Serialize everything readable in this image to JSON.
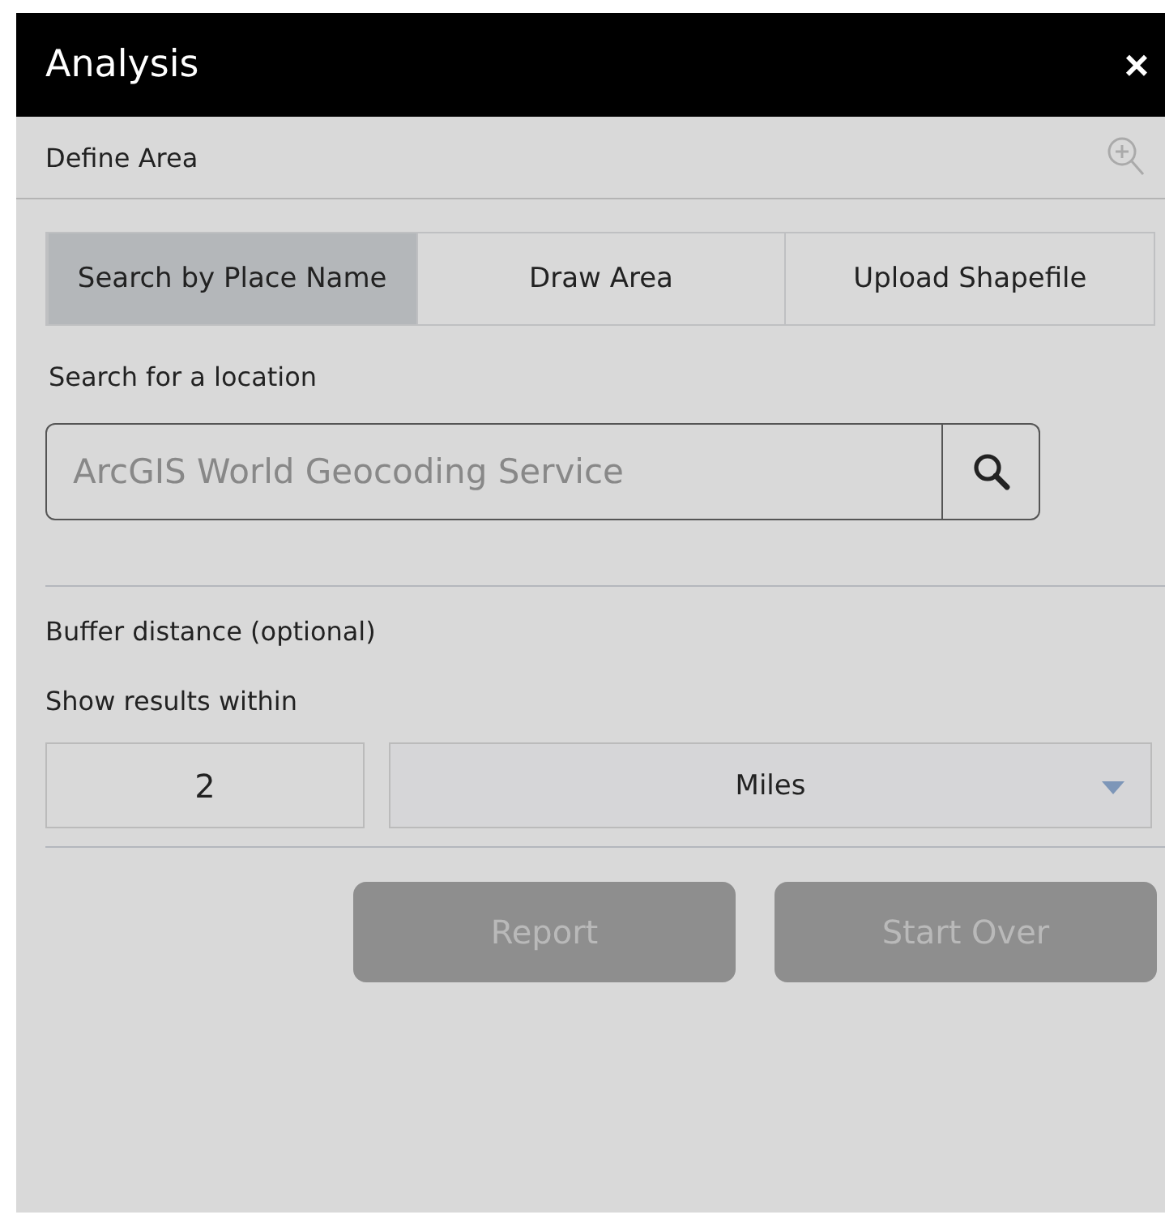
{
  "window": {
    "title": "Analysis",
    "close": "×"
  },
  "section": {
    "title": "Define Area"
  },
  "tabs": [
    {
      "label": "Search by Place Name",
      "selected": true
    },
    {
      "label": "Draw Area",
      "selected": false
    },
    {
      "label": "Upload Shapefile",
      "selected": false
    }
  ],
  "search": {
    "label": "Search for a location",
    "placeholder": "ArcGIS World Geocoding Service"
  },
  "buffer": {
    "title": "Buffer distance (optional)",
    "label": "Show results within",
    "distance": "2",
    "unit": "Miles"
  },
  "buttons": [
    {
      "label": "Report",
      "disabled": true
    },
    {
      "label": "Start Over",
      "disabled": true
    }
  ]
}
